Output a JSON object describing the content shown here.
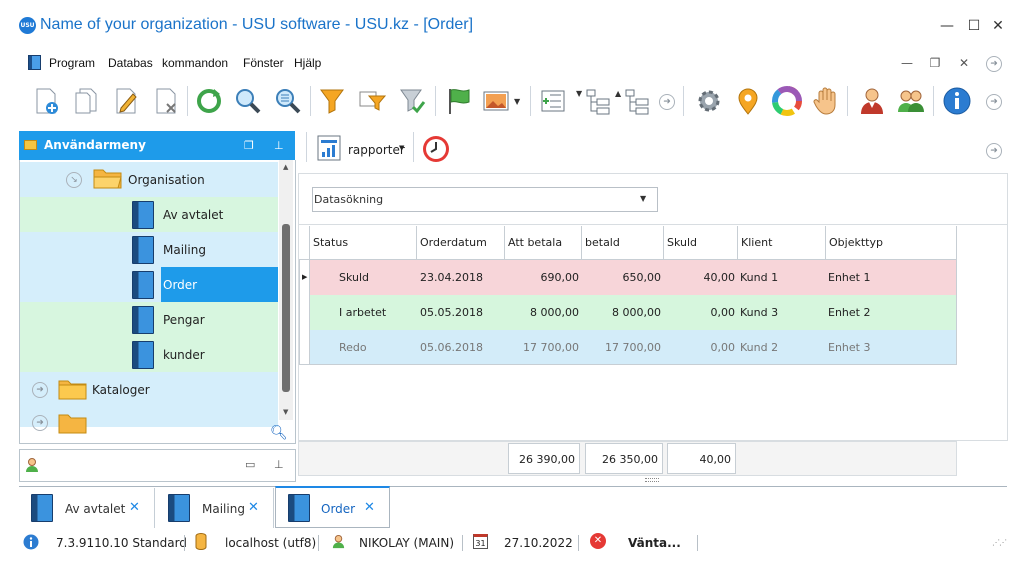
{
  "window": {
    "logo_text": "USU",
    "title": "Name of your organization - USU software - USU.kz - [Order]",
    "minimize": "—",
    "maximize": "☐",
    "close": "✕"
  },
  "menu": {
    "items": [
      "Program",
      "Databas",
      "kommandon",
      "Fönster",
      "Hjälp"
    ],
    "mdi_minimize": "—",
    "mdi_restore": "❐",
    "mdi_close": "✕"
  },
  "left_panel": {
    "title": "Användarmeny",
    "tree": [
      {
        "label": "Organisation",
        "type": "folder",
        "row": "blue"
      },
      {
        "label": "Av avtalet",
        "type": "book",
        "row": "green"
      },
      {
        "label": "Mailing",
        "type": "book",
        "row": "blue"
      },
      {
        "label": "Order",
        "type": "book",
        "row": "blue",
        "selected": true
      },
      {
        "label": "Pengar",
        "type": "book",
        "row": "green"
      },
      {
        "label": "kunder",
        "type": "book",
        "row": "green"
      },
      {
        "label": "Kataloger",
        "type": "folder",
        "row": "blue"
      }
    ]
  },
  "report_bar": {
    "rapporter_label": "rapporter"
  },
  "search": {
    "placeholder": "Datasökning"
  },
  "grid": {
    "columns": [
      "Status",
      "Orderdatum",
      "Att betala",
      "betald",
      "Skuld",
      "Klient",
      "Objekttyp"
    ],
    "rows": [
      {
        "status": "Skuld",
        "date": "23.04.2018",
        "to_pay": "690,00",
        "paid": "650,00",
        "debt": "40,00",
        "client": "Kund 1",
        "object": "Enhet 1",
        "color": "#f7d5d9",
        "text_color": "#222"
      },
      {
        "status": "I arbetet",
        "date": "05.05.2018",
        "to_pay": "8 000,00",
        "paid": "8 000,00",
        "debt": "0,00",
        "client": "Kund 3",
        "object": "Enhet 2",
        "color": "#d6f6dd",
        "text_color": "#222"
      },
      {
        "status": "Redo",
        "date": "05.06.2018",
        "to_pay": "17 700,00",
        "paid": "17 700,00",
        "debt": "0,00",
        "client": "Kund 2",
        "object": "Enhet 3",
        "color": "#d3ecf9",
        "text_color": "#777"
      }
    ],
    "totals": {
      "to_pay": "26 390,00",
      "paid": "26 350,00",
      "debt": "40,00"
    }
  },
  "tabs": [
    {
      "label": "Av avtalet",
      "active": false
    },
    {
      "label": "Mailing",
      "active": false
    },
    {
      "label": "Order",
      "active": true
    }
  ],
  "status": {
    "version": "7.3.9110.10 Standard",
    "db": "localhost (utf8)",
    "user": "NIKOLAY (MAIN)",
    "date": "27.10.2022",
    "calendar_day": "31",
    "waiting": "Vänta..."
  }
}
